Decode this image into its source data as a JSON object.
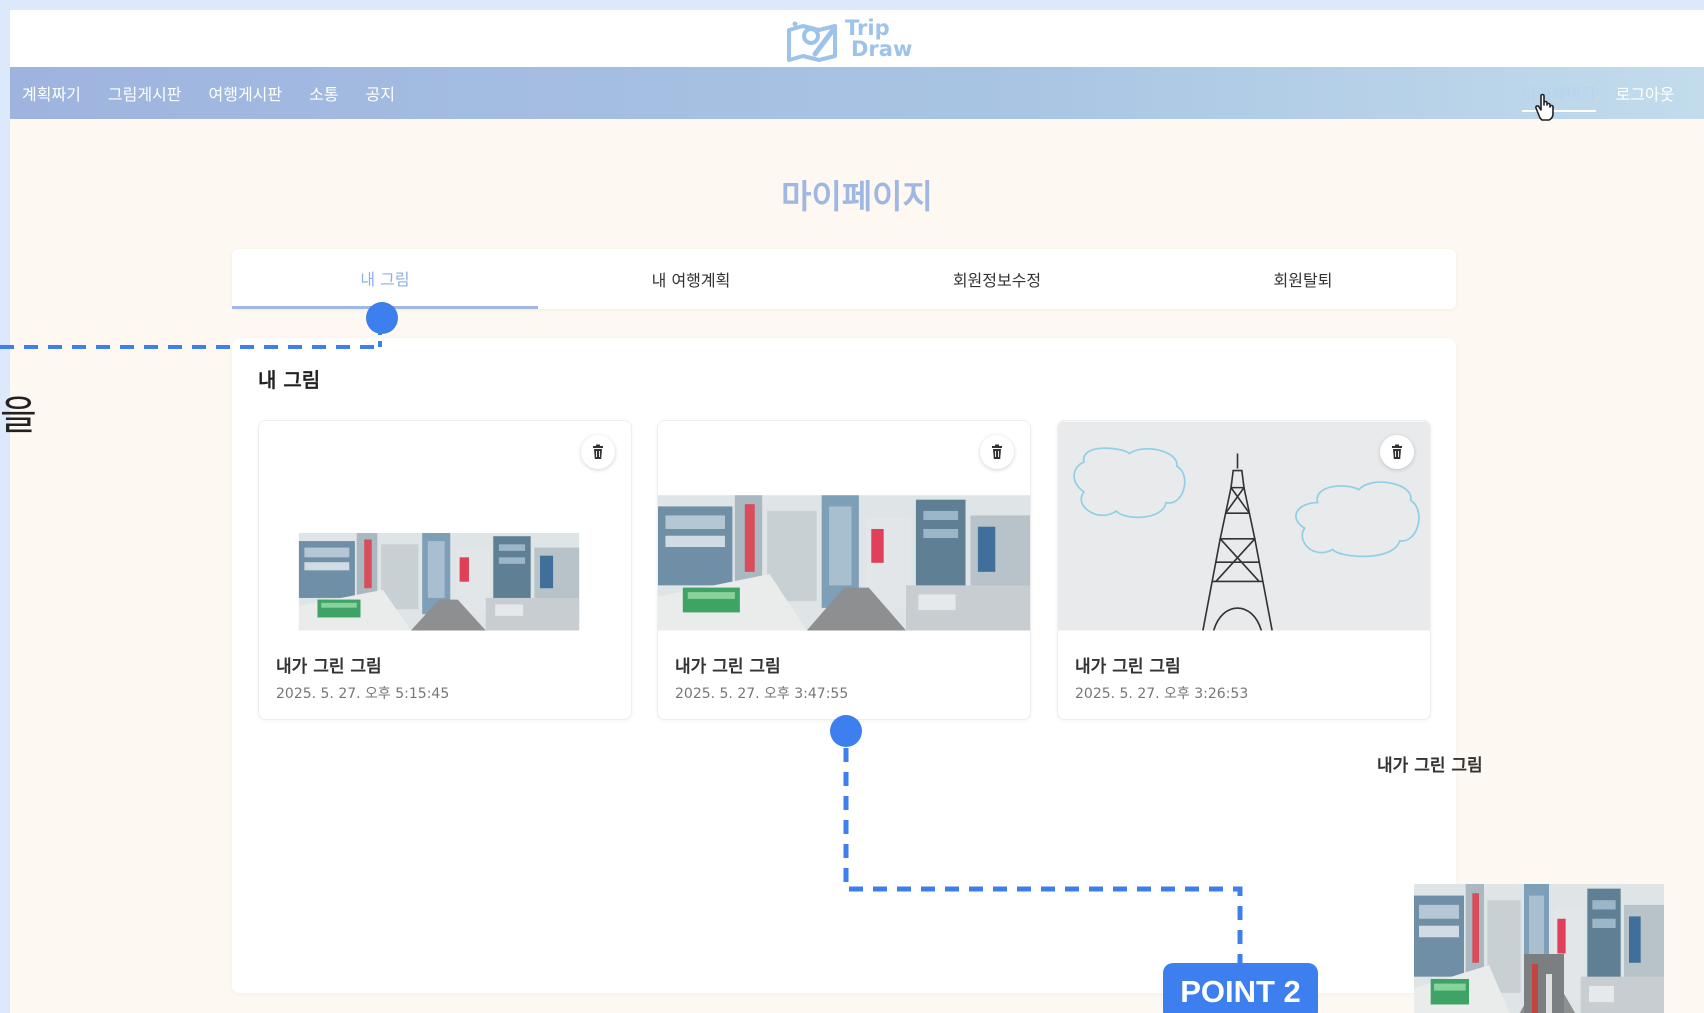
{
  "header": {
    "logo_line1": "Trip",
    "logo_line2": "Draw"
  },
  "nav": {
    "items": [
      "계획짜기",
      "그림게시판",
      "여행게시판",
      "소통",
      "공지"
    ],
    "mypage": "마이페이지",
    "logout": "로그아웃"
  },
  "page": {
    "title": "마이페이지"
  },
  "tabs": [
    {
      "label": "내 그림",
      "active": true
    },
    {
      "label": "내 여행계획",
      "active": false
    },
    {
      "label": "회원정보수정",
      "active": false
    },
    {
      "label": "회원탈퇴",
      "active": false
    }
  ],
  "section": {
    "title": "내 그림"
  },
  "cards": [
    {
      "title": "내가 그린 그림",
      "date": "2025. 5. 27. 오후 5:15:45",
      "image": "city-street-photo"
    },
    {
      "title": "내가 그린 그림",
      "date": "2025. 5. 27. 오후 3:47:55",
      "image": "city-street-photo"
    },
    {
      "title": "내가 그린 그림",
      "date": "2025. 5. 27. 오후 3:26:53",
      "image": "eiffel-tower-drawing"
    }
  ],
  "detail": {
    "title": "내가 그린 그림"
  },
  "annotation": {
    "side_text": "을",
    "point_label": "POINT 2",
    "accent": "#3e7ff0"
  },
  "colors": {
    "brand": "#9fb7e2",
    "nav_gradient_start": "#9eb4df",
    "nav_gradient_end": "#c2dcec",
    "background": "#fdf8f1"
  },
  "icons": [
    "trash-icon",
    "hand-cursor-icon",
    "logo-icon"
  ]
}
